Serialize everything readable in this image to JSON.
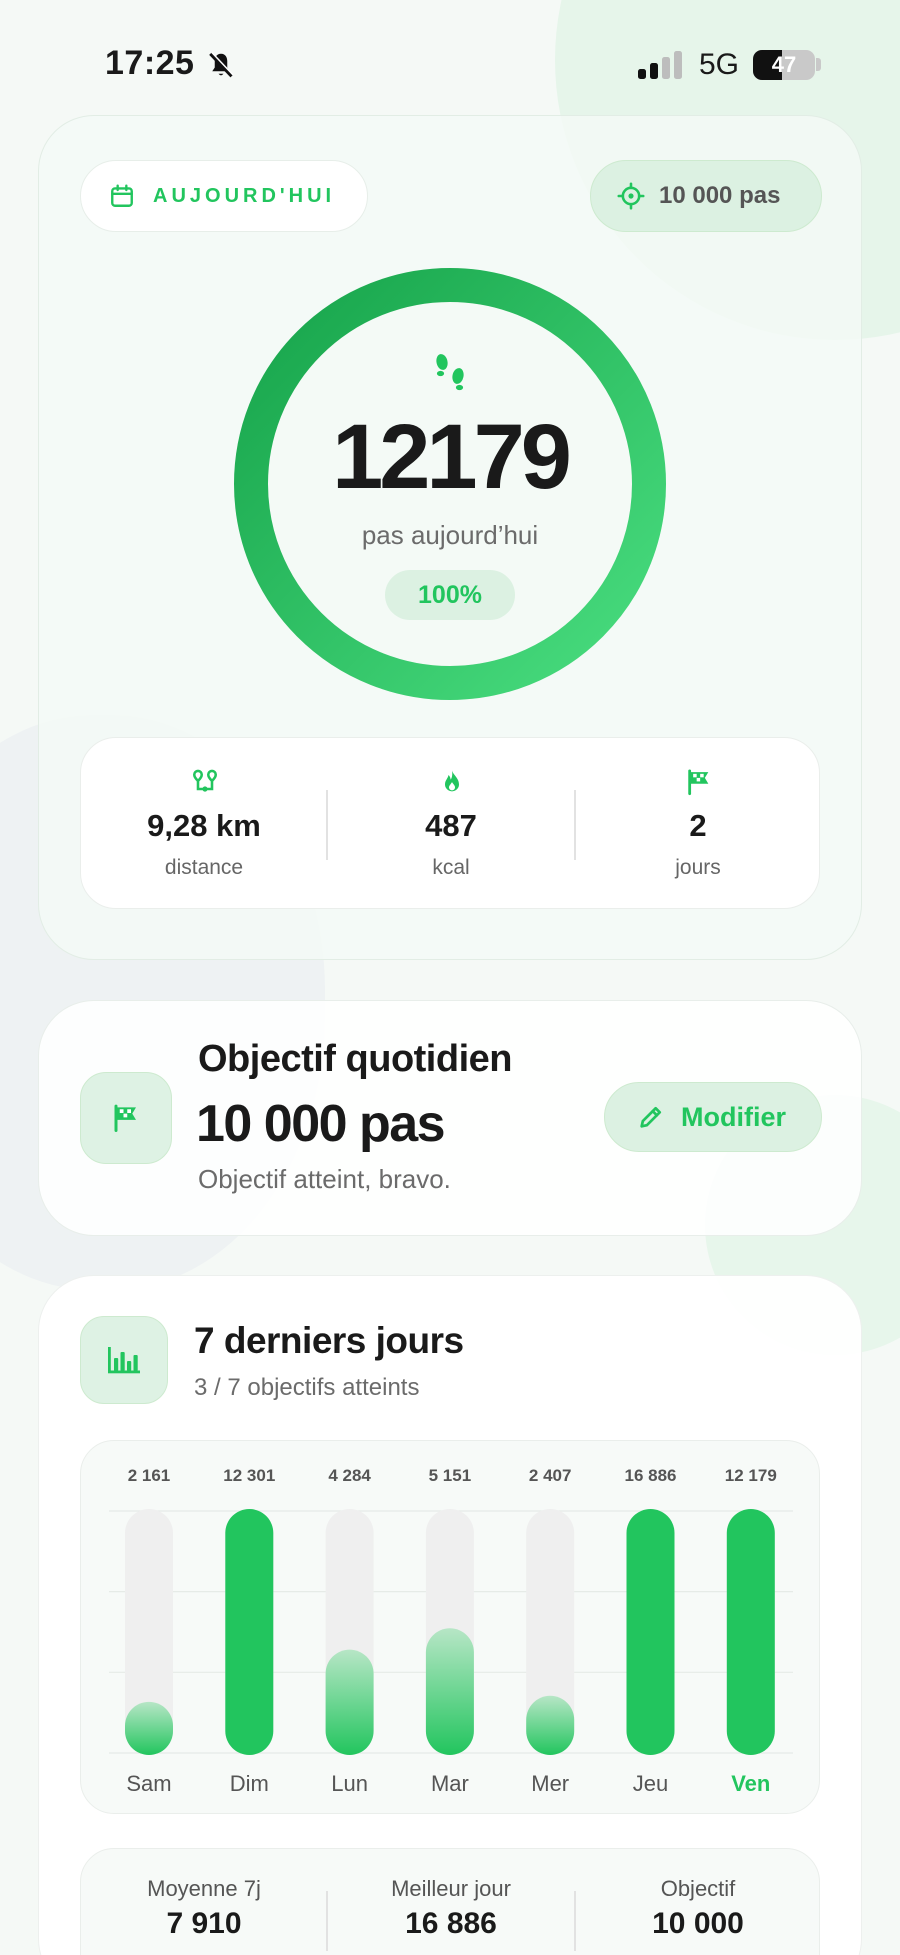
{
  "status_bar": {
    "time": "17:25",
    "network": "5G",
    "battery_level": "47",
    "battery_fraction": 0.47
  },
  "today": {
    "label": "AUJOURD'HUI",
    "goal_pill": "10 000 pas",
    "steps": "12179",
    "steps_caption": "pas aujourd’hui",
    "percent": "100%",
    "progress": 1.0,
    "stats": [
      {
        "icon": "route-icon",
        "value": "9,28 km",
        "label": "distance"
      },
      {
        "icon": "flame-icon",
        "value": "487",
        "label": "kcal"
      },
      {
        "icon": "flag-icon",
        "value": "2",
        "label": "jours"
      }
    ]
  },
  "objective": {
    "title": "Objectif quotidien",
    "value": "10 000 pas",
    "note": "Objectif atteint, bravo.",
    "modify_label": "Modifier"
  },
  "week": {
    "title": "7 derniers jours",
    "subtitle": "3 / 7 objectifs atteints",
    "summary": [
      {
        "label": "Moyenne 7j",
        "value": "7 910"
      },
      {
        "label": "Meilleur jour",
        "value": "16 886"
      },
      {
        "label": "Objectif",
        "value": "10 000"
      }
    ]
  },
  "colors": {
    "accent": "#22c55e",
    "track": "#efefef",
    "text": "#1a1a1a",
    "muted": "#6b6b6b"
  },
  "chart_data": {
    "type": "bar",
    "categories": [
      "Sam",
      "Dim",
      "Lun",
      "Mar",
      "Mer",
      "Jeu",
      "Ven"
    ],
    "values": [
      2161,
      12301,
      4284,
      5151,
      2407,
      16886,
      12179
    ],
    "value_labels": [
      "2 161",
      "12 301",
      "4 284",
      "5 151",
      "2 407",
      "16 886",
      "12 179"
    ],
    "goal": 10000,
    "highlight_index": 6,
    "grid": true
  }
}
